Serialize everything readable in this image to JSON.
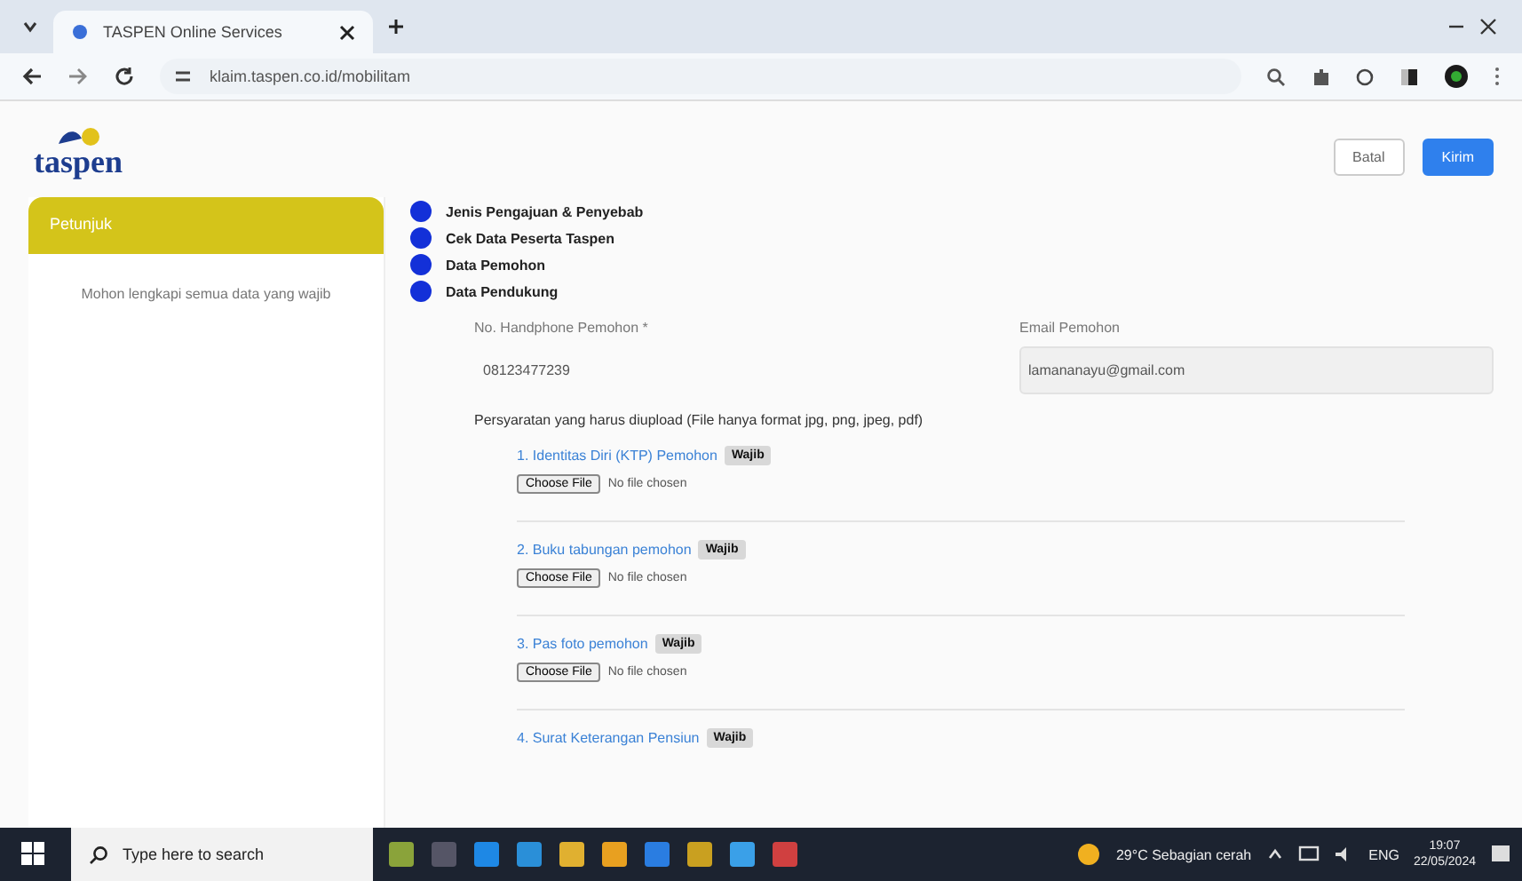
{
  "browser": {
    "tab_title": "TASPEN Online Services",
    "url": "klaim.taspen.co.id/mobilitam"
  },
  "header": {
    "logo": "taspen",
    "buttons": [
      {
        "label": "Batal",
        "kind": "secondary"
      },
      {
        "label": "Kirim",
        "kind": "primary"
      }
    ]
  },
  "sidebar": {
    "title": "Petunjuk",
    "text": "Mohon lengkapi semua data yang wajib"
  },
  "steps": [
    {
      "label": "Jenis Pengajuan & Penyebab",
      "done": true
    },
    {
      "label": "Cek Data Peserta Taspen",
      "done": true
    },
    {
      "label": "Data Pemohon",
      "done": true
    },
    {
      "label": "Data Pendukung",
      "done": true
    }
  ],
  "fields": [
    {
      "label": "No. Handphone Pemohon *",
      "value": "08123477239",
      "boxed": false
    },
    {
      "label": "Email Pemohon",
      "value": "lamananayu@gmail.com",
      "boxed": true
    }
  ],
  "uploads_title": "Persyaratan yang harus diupload (File hanya format jpg, png, jpeg, pdf)",
  "uploads": [
    {
      "label": "1. Identitas Diri (KTP) Pemohon",
      "badge": "Wajib",
      "button": "Choose File",
      "status": "No file chosen"
    },
    {
      "label": "2. Buku tabungan pemohon",
      "badge": "Wajib",
      "button": "Choose File",
      "status": "No file chosen"
    },
    {
      "label": "3. Pas foto pemohon",
      "badge": "Wajib",
      "button": "Choose File",
      "status": "No file chosen"
    },
    {
      "label": "4. Surat Keterangan Pensiun",
      "badge": "Wajib"
    }
  ],
  "taskbar": {
    "search": "Type here to search",
    "weather": "29°C Sebagian cerah",
    "lang": "ENG",
    "time": "19:07",
    "date": "22/05/2024"
  }
}
